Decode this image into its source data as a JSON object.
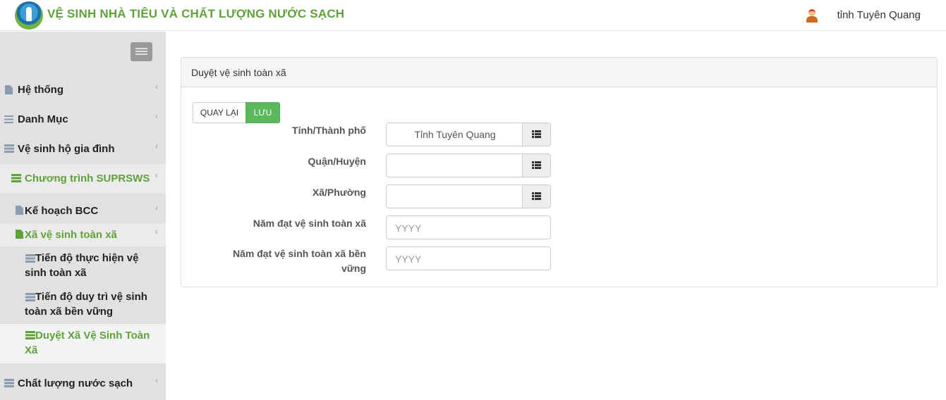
{
  "header": {
    "app_title": "VỆ SINH NHÀ TIÊU VÀ CHẤT LƯỢNG NƯỚC SẠCH",
    "user_name": "tỉnh Tuyên Quang",
    "user_chevron": "﹀"
  },
  "sidebar": {
    "chevron": "‹",
    "items": [
      {
        "label": "Hệ thống",
        "icon": "file-icon"
      },
      {
        "label": "Danh Mục",
        "icon": "list-icon"
      },
      {
        "label": "Vệ sinh hộ gia đình",
        "icon": "server-icon"
      },
      {
        "label": "Chương trình SUPRSWS",
        "icon": "server-icon"
      },
      {
        "label": "Kế hoạch BCC",
        "icon": "file-icon"
      },
      {
        "label": "Xã vệ sinh toàn xã",
        "icon": "file-icon"
      },
      {
        "label_line1": "Tiến độ thực hiện vệ",
        "label_line2": "sinh toàn xã",
        "icon": "server-icon"
      },
      {
        "label_line1": "Tiến độ duy trì vệ sinh",
        "label_line2": "toàn xã bền vững",
        "icon": "server-icon"
      },
      {
        "label_line1": "Duyệt Xã Vệ Sinh Toàn",
        "label_line2": "Xã",
        "icon": "server-icon"
      },
      {
        "label": "Chất lượng nước sạch",
        "icon": "server-icon"
      }
    ],
    "active_color": "#5fa13a"
  },
  "panel": {
    "title": "Duyệt vệ sinh toàn xã",
    "back_button": "QUAY LẠI",
    "save_button": "LƯU",
    "fields": [
      {
        "label": "Tỉnh/Thành phố",
        "value": "Tỉnh Tuyên Quang"
      },
      {
        "label": "Quận/Huyện",
        "value": ""
      },
      {
        "label": "Xã/Phường",
        "value": ""
      },
      {
        "label": "Năm đạt vệ sinh toàn xã",
        "placeholder": "YYYY"
      },
      {
        "label_line1": "Năm đạt vệ sinh toàn xã bền",
        "label_line2": "vững",
        "placeholder": "YYYY"
      }
    ]
  }
}
